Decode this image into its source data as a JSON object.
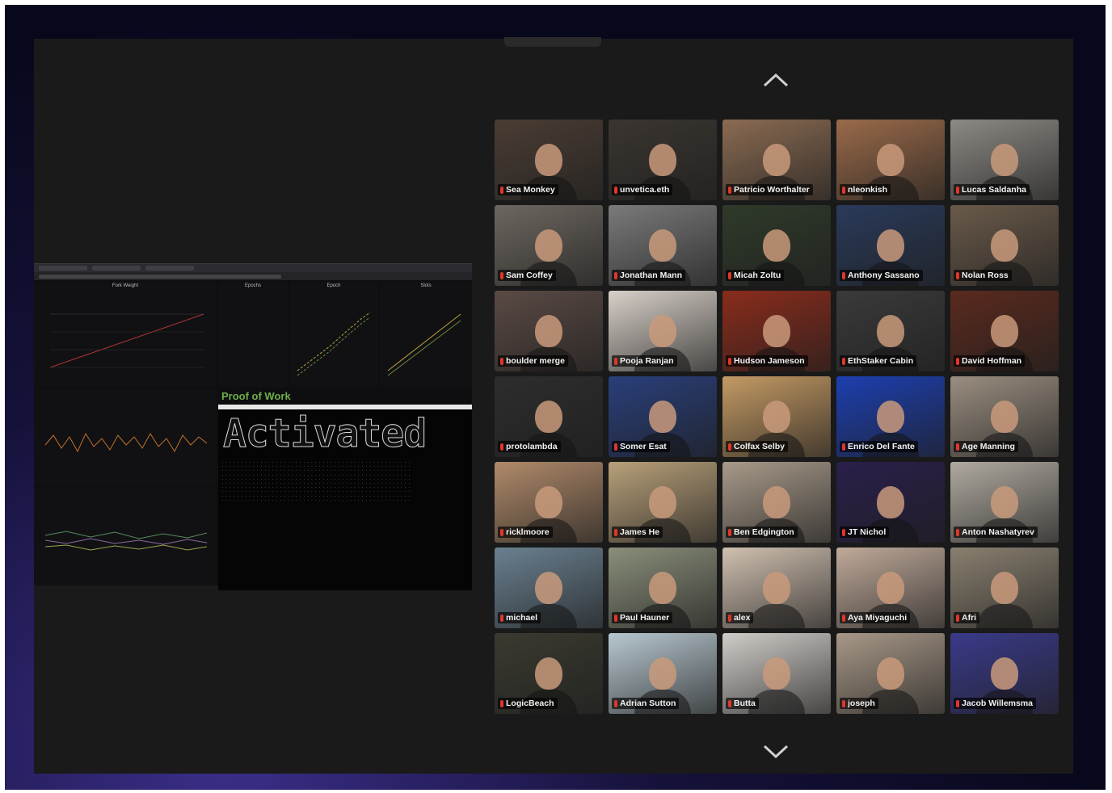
{
  "dashboard": {
    "panels": [
      "Fork Weight",
      "Epochs",
      "Epoch",
      "Slots"
    ],
    "proof_label": "Proof of Work",
    "terminal_banner": "Activated"
  },
  "participants": [
    "Sea Monkey",
    "unvetica.eth",
    "Patricio Worthalter",
    "nleonkish",
    "Lucas Saldanha",
    "Sam Coffey",
    "Jonathan Mann",
    "Micah Zoltu",
    "Anthony Sassano",
    "Nolan Ross",
    "boulder merge",
    "Pooja Ranjan",
    "Hudson Jameson",
    "EthStaker Cabin",
    "David Hoffman",
    "protolambda",
    "Somer Esat",
    "Colfax Selby",
    "Enrico Del Fante",
    "Age Manning",
    "ricklmoore",
    "James He",
    "Ben Edgington",
    "JT Nichol",
    "Anton Nashatyrev",
    "michael",
    "Paul Hauner",
    "alex",
    "Aya Miyaguchi",
    "Afri",
    "LogicBeach",
    "Adrian Sutton",
    "Butta",
    "joseph",
    "Jacob Willemsma"
  ],
  "tile_colors": [
    "#4a3d33",
    "#3a3530",
    "#8a6b52",
    "#9a6a4a",
    "#8d8a84",
    "#6d6760",
    "#7a7a7a",
    "#2f3a2a",
    "#2a3a5a",
    "#6a5a4a",
    "#5a4a44",
    "#d8d0c8",
    "#8a2c1c",
    "#3a3a3a",
    "#5a2a1e",
    "#2d2d2d",
    "#2a3f7a",
    "#c49a64",
    "#1d3fb0",
    "#9a8e80",
    "#b08a6a",
    "#b8a07a",
    "#a89a8a",
    "#2a1f4a",
    "#b0aaa0",
    "#6a8090",
    "#8a8f7a",
    "#d0c0b0",
    "#c0aa9a",
    "#8a8070",
    "#3a3a30",
    "#b8c8d0",
    "#d0ccc8",
    "#a89888",
    "#3a3a8a"
  ]
}
